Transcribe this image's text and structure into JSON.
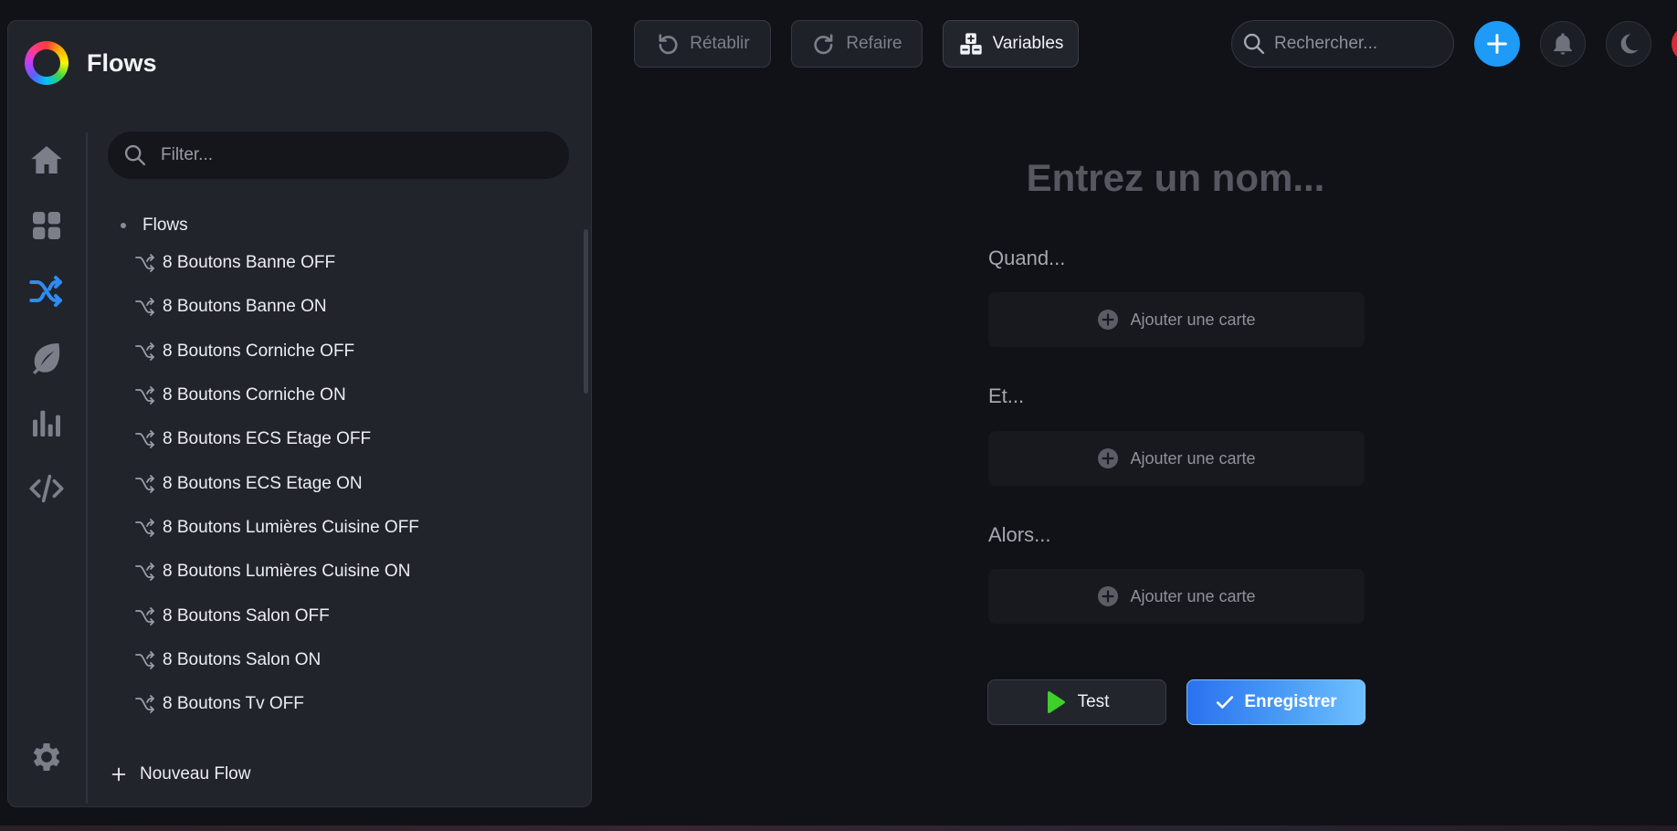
{
  "app": {
    "title": "Flows"
  },
  "sidebar": {
    "filter_placeholder": "Filter...",
    "nav": [
      {
        "name": "home-icon",
        "active": false
      },
      {
        "name": "devices-icon",
        "active": false
      },
      {
        "name": "flows-icon",
        "active": true
      },
      {
        "name": "energy-icon",
        "active": false
      },
      {
        "name": "insights-icon",
        "active": false
      },
      {
        "name": "developer-icon",
        "active": false
      }
    ],
    "settings_icon": "gear-icon",
    "tree_root": "Flows",
    "flows": [
      "8 Boutons Banne OFF",
      "8 Boutons Banne ON",
      "8 Boutons Corniche OFF",
      "8 Boutons Corniche ON",
      "8 Boutons ECS Etage OFF",
      "8 Boutons ECS Etage ON",
      "8 Boutons Lumières Cuisine OFF",
      "8 Boutons Lumières Cuisine ON",
      "8 Boutons Salon OFF",
      "8 Boutons Salon ON",
      "8 Boutons Tv OFF"
    ],
    "new_flow_label": "Nouveau Flow"
  },
  "toolbar": {
    "undo_label": "Rétablir",
    "redo_label": "Refaire",
    "variables_label": "Variables",
    "search_placeholder": "Rechercher..."
  },
  "editor": {
    "name_placeholder": "Entrez un nom...",
    "when_label": "Quand...",
    "and_label": "Et...",
    "then_label": "Alors...",
    "add_card_label": "Ajouter une carte",
    "test_label": "Test",
    "save_label": "Enregistrer"
  },
  "colors": {
    "accent": "#1e9af7",
    "active_nav": "#2f8cf0",
    "test_play": "#3ecf2a",
    "background": "#111217",
    "panel": "#22242c"
  }
}
